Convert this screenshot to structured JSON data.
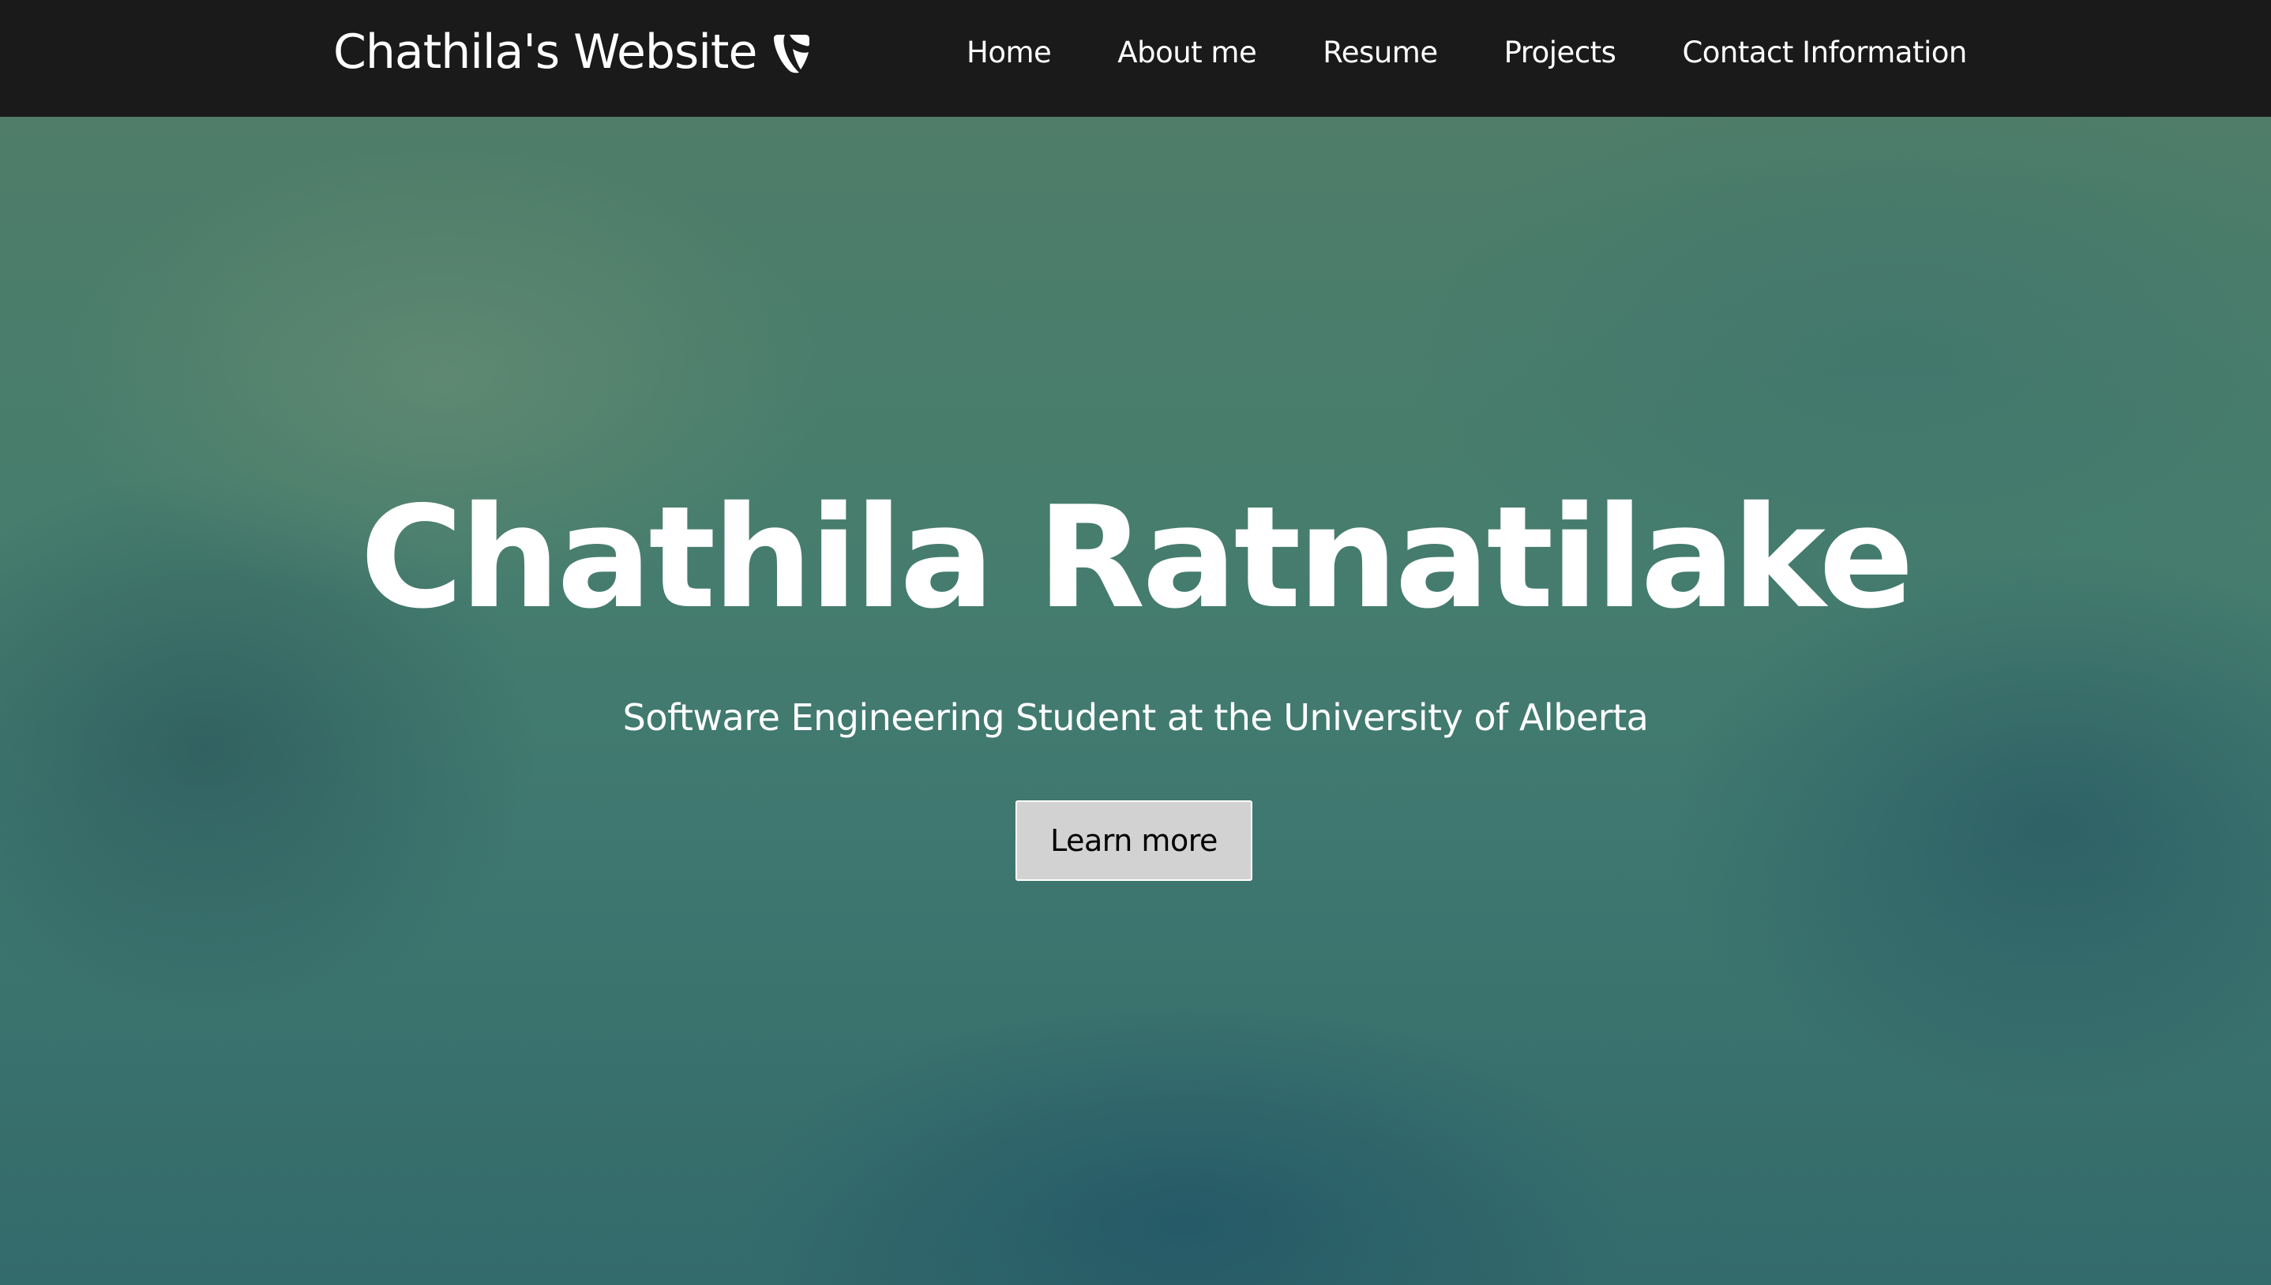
{
  "navbar": {
    "brand_text": "Chathila's Website",
    "brand_icon": "typo3-logo-icon",
    "links": [
      {
        "label": "Home"
      },
      {
        "label": "About me"
      },
      {
        "label": "Resume"
      },
      {
        "label": "Projects"
      },
      {
        "label": "Contact Information"
      }
    ]
  },
  "hero": {
    "title": "Chathila Ratnatilake",
    "subtitle": "Software Engineering Student at the University of Alberta",
    "button_label": "Learn more"
  },
  "colors": {
    "navbar_background": "#1b1a1b",
    "hero_background": "#467d6d",
    "button_background": "#d2d2d2",
    "text_light": "#ffffff",
    "button_text": "#000000"
  }
}
